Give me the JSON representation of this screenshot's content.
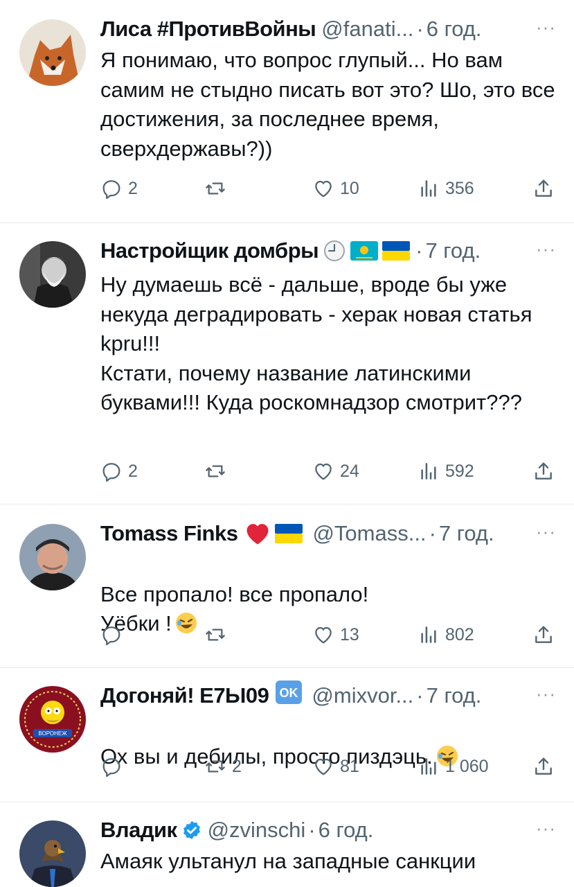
{
  "tweets": [
    {
      "name": "Лиса #ПротивВойны",
      "handle": "@fanati...",
      "sep": "·",
      "time": "6 год.",
      "more": "···",
      "text": "Я понимаю, что вопрос глупый... Но вам самим не стыдно писать вот это? Шо, это все достижения, за последнее время, сверхдержавы?))",
      "replies": "2",
      "retweets": "",
      "likes": "10",
      "views": "356"
    },
    {
      "name": "Настройщик домбры",
      "handle": "",
      "sep": "·",
      "time": "7 год.",
      "more": "···",
      "text": "Ну думаешь всё - дальше, вроде бы уже некуда деградировать - херак новая статья kpru!!!\n Кстати, почему название латинскими буквами!!! Куда роскомнадзор смотрит???",
      "replies": "2",
      "retweets": "",
      "likes": "24",
      "views": "592"
    },
    {
      "name": "Tomass Finks",
      "handle": "@Tomass...",
      "sep": "·",
      "time": "7 год.",
      "more": "···",
      "text": "Все пропало! все пропало!\nУёбки !",
      "replies": "",
      "retweets": "",
      "likes": "13",
      "views": "802"
    },
    {
      "name": "Догоняй! Е7Ы09",
      "handle": "@mixvor...",
      "sep": "·",
      "time": "7 год.",
      "more": "···",
      "text": "Ох вы и дебилы, просто пиздэць.",
      "replies": "",
      "retweets": "2",
      "likes": "81",
      "views": "1 060"
    },
    {
      "name": "Владик",
      "handle": "@zvinschi",
      "sep": "·",
      "time": "6 год.",
      "more": "···",
      "text": "Амаяк ультанул на западные санкции"
    }
  ],
  "icons": {
    "reply": "reply-icon",
    "retweet": "retweet-icon",
    "like": "heart-icon",
    "views": "views-icon",
    "share": "share-icon"
  },
  "badges": {
    "ok": "OK"
  },
  "colors": {
    "text": "#0f1419",
    "secondary": "#536471",
    "divider": "#e6e9ec",
    "verified": "#1d9bf0"
  }
}
